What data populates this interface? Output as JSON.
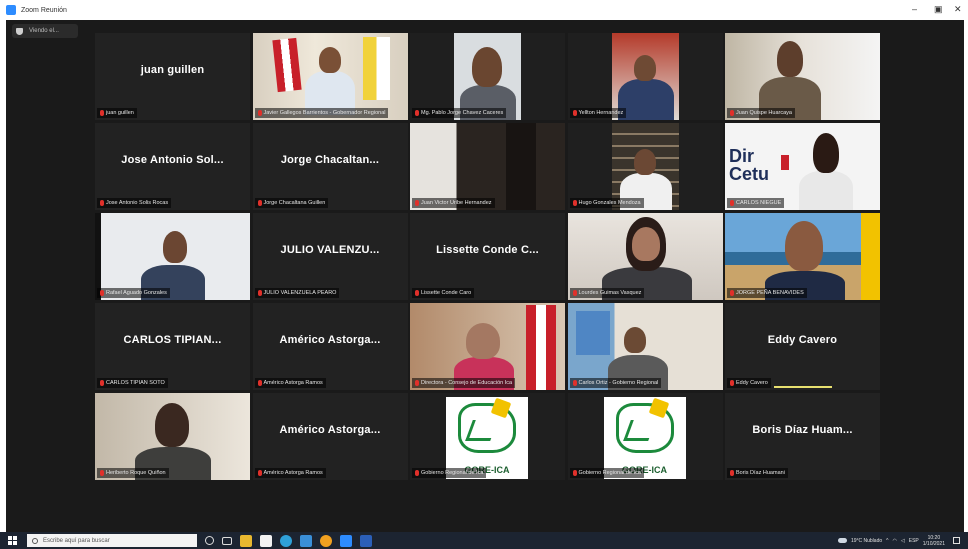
{
  "window": {
    "title": "Zoom Reunión",
    "minimize": "–",
    "maximize": "▣",
    "close": "✕"
  },
  "view_button": {
    "label": "Viendo el..."
  },
  "tiles": [
    {
      "big_name": "juan guillen",
      "caption": "juan guillen",
      "type": "name"
    },
    {
      "big_name": "",
      "caption": "Javier Gallegos Barrientos - Gobernador Regional",
      "type": "video",
      "scene": "flags",
      "highlighted": true
    },
    {
      "big_name": "",
      "caption": "Mg. Pablo Jorge Chavez Caceres",
      "type": "video",
      "scene": "face-center"
    },
    {
      "big_name": "",
      "caption": "Yellton Hernandez",
      "type": "video",
      "scene": "office-red"
    },
    {
      "big_name": "",
      "caption": "Juan Quispe Huarcaya",
      "type": "video",
      "scene": "office-light"
    },
    {
      "big_name": "Jose Antonio Sol...",
      "caption": "Jose Antonio Solis Rocas",
      "type": "name"
    },
    {
      "big_name": "Jorge Chacaltan...",
      "caption": "Jorge Chacaltana Guillen",
      "type": "name"
    },
    {
      "big_name": "",
      "caption": "Juan Victor Uribe Hernandez",
      "type": "video",
      "scene": "dark-room"
    },
    {
      "big_name": "",
      "caption": "Hugo Gonzales Mendoza",
      "type": "video",
      "scene": "shelves"
    },
    {
      "big_name": "",
      "caption": "CARLOS NIEGUE",
      "type": "video",
      "scene": "banner",
      "banner_text": [
        "Dir",
        "Cetu"
      ]
    },
    {
      "big_name": "",
      "caption": "Rafael Aguado Gonzales",
      "type": "video",
      "scene": "office-blue"
    },
    {
      "big_name": "JULIO VALENZU...",
      "caption": "JULIO VALENZUELA PEARO",
      "type": "name"
    },
    {
      "big_name": "Lissette Conde C...",
      "caption": "Lissette Conde Caro",
      "type": "name"
    },
    {
      "big_name": "",
      "caption": "Lourdes Guimas Vasquez",
      "type": "video",
      "scene": "young-woman"
    },
    {
      "big_name": "",
      "caption": "JORGE PEÑA BENAVIDES",
      "type": "video",
      "scene": "coast"
    },
    {
      "big_name": "CARLOS TIPIAN...",
      "caption": "CARLOS TIPIAN SOTO",
      "type": "name"
    },
    {
      "big_name": "Américo Astorga...",
      "caption": "Américo Astorga Ramos",
      "type": "name"
    },
    {
      "big_name": "",
      "caption": "Directora - Consejo de Educación Ica",
      "type": "video",
      "scene": "woman-flag"
    },
    {
      "big_name": "",
      "caption": "Carlos Ortiz - Gobierno Regional",
      "type": "video",
      "scene": "flag-room"
    },
    {
      "big_name": "Eddy Cavero",
      "caption": "Eddy Cavero",
      "type": "name",
      "speaking": true
    },
    {
      "big_name": "",
      "caption": "Heriberto Roque Quiñon",
      "type": "video",
      "scene": "man-room"
    },
    {
      "big_name": "Américo Astorga...",
      "caption": "Américo Astorga Ramos",
      "type": "name"
    },
    {
      "big_name": "",
      "caption": "Gobierno Regional de Ica",
      "type": "logo",
      "logo_text": "GORE-ICA"
    },
    {
      "big_name": "",
      "caption": "Gobierno Regional de Ica",
      "type": "logo",
      "logo_text": "GORE-ICA"
    },
    {
      "big_name": "Boris Díaz Huam...",
      "caption": "Boris Díaz Huamani",
      "type": "name"
    }
  ],
  "taskbar": {
    "search_placeholder": "Escribe aquí para buscar",
    "weather": "19°C Nublado",
    "time": "10:20",
    "date": "1/10/2021",
    "lang": "ESP"
  },
  "colors": {
    "zoom_bg": "#1a1a1a",
    "tile_bg": "#222222",
    "active_speaker": "#e8e070",
    "muted_mic": "#e0302a",
    "taskbar": "#1c2431"
  }
}
